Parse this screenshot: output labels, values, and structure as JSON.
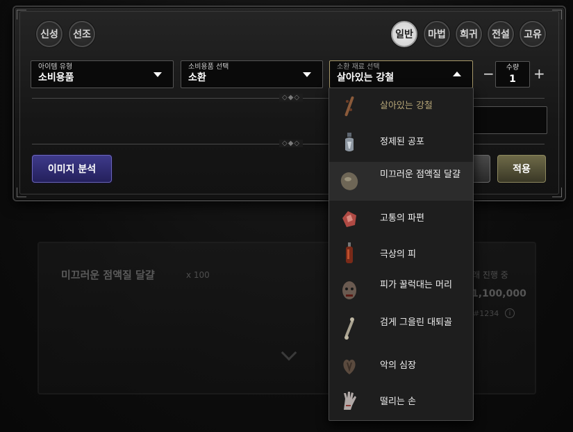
{
  "rarity_left": [
    "신성",
    "선조"
  ],
  "rarity_right": [
    "일반",
    "마법",
    "희귀",
    "전설",
    "고유"
  ],
  "rarity_active": "일반",
  "item_type": {
    "label": "아이템 유형",
    "value": "소비용품"
  },
  "consumable": {
    "label": "소비용품 선택",
    "value": "소환"
  },
  "summon_material": {
    "label": "소환 재료 선택",
    "value": "살아있는 강철"
  },
  "quantity": {
    "label": "수량",
    "value": "1",
    "minus": "−",
    "plus": "+"
  },
  "divider_ornament": "◇◆◇",
  "buttons": {
    "analyze": "이미지 분석",
    "apply": "적용"
  },
  "dropdown_options": [
    {
      "label": "살아있는 강철",
      "icon": "living-steel-icon",
      "selected": true
    },
    {
      "label": "정제된 공포",
      "icon": "distilled-fear-icon"
    },
    {
      "label": "미끄러운 점액질 달걀",
      "icon": "slimy-egg-icon",
      "hover": true
    },
    {
      "label": "고통의 파편",
      "icon": "shard-of-agony-icon"
    },
    {
      "label": "극상의 피",
      "icon": "exquisite-blood-icon"
    },
    {
      "label": "피가 꿀럭대는 머리",
      "icon": "blood-soaked-head-icon"
    },
    {
      "label": "검게 그을린 대퇴골",
      "icon": "blackened-femur-icon"
    },
    {
      "label": "악의 심장",
      "icon": "malignant-heart-icon"
    },
    {
      "label": "떨리는 손",
      "icon": "trembling-hand-icon"
    }
  ],
  "result_card": {
    "title": "미끄러운 점액질 달걀",
    "count": "x 100",
    "status": "래 진행 중",
    "price": "1,100,000",
    "id": "#1234",
    "info_glyph": "i"
  }
}
